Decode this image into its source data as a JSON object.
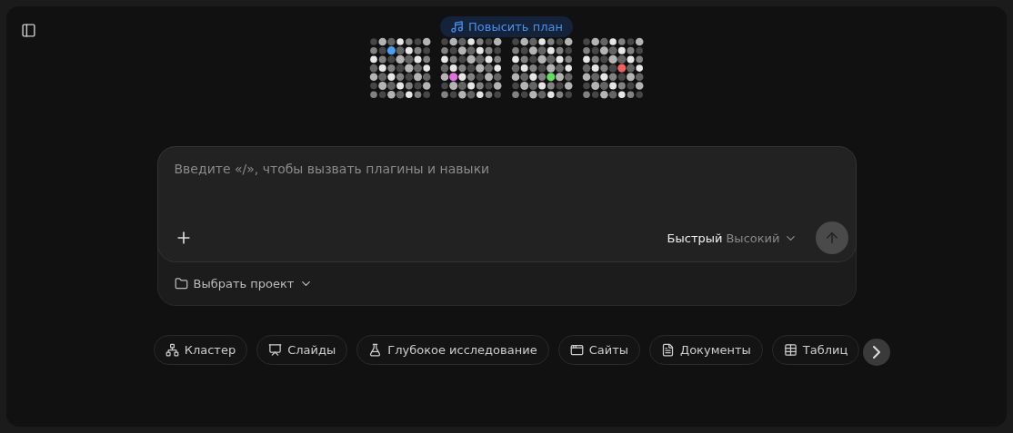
{
  "upgrade_badge": {
    "label": "Повысить план"
  },
  "composer": {
    "placeholder": "Введите «/», чтобы вызвать плагины и навыки",
    "mode_selected": "Быстрый",
    "mode_other": "Высокий",
    "project": "Выбрать проект"
  },
  "chips": [
    {
      "label": "Кластер",
      "kind": "cluster"
    },
    {
      "label": "Слайды",
      "kind": "slides"
    },
    {
      "label": "Глубокое исследование",
      "kind": "research"
    },
    {
      "label": "Сайты",
      "kind": "sites"
    },
    {
      "label": "Документы",
      "kind": "docs"
    },
    {
      "label": "Таблиц",
      "kind": "tables"
    }
  ]
}
